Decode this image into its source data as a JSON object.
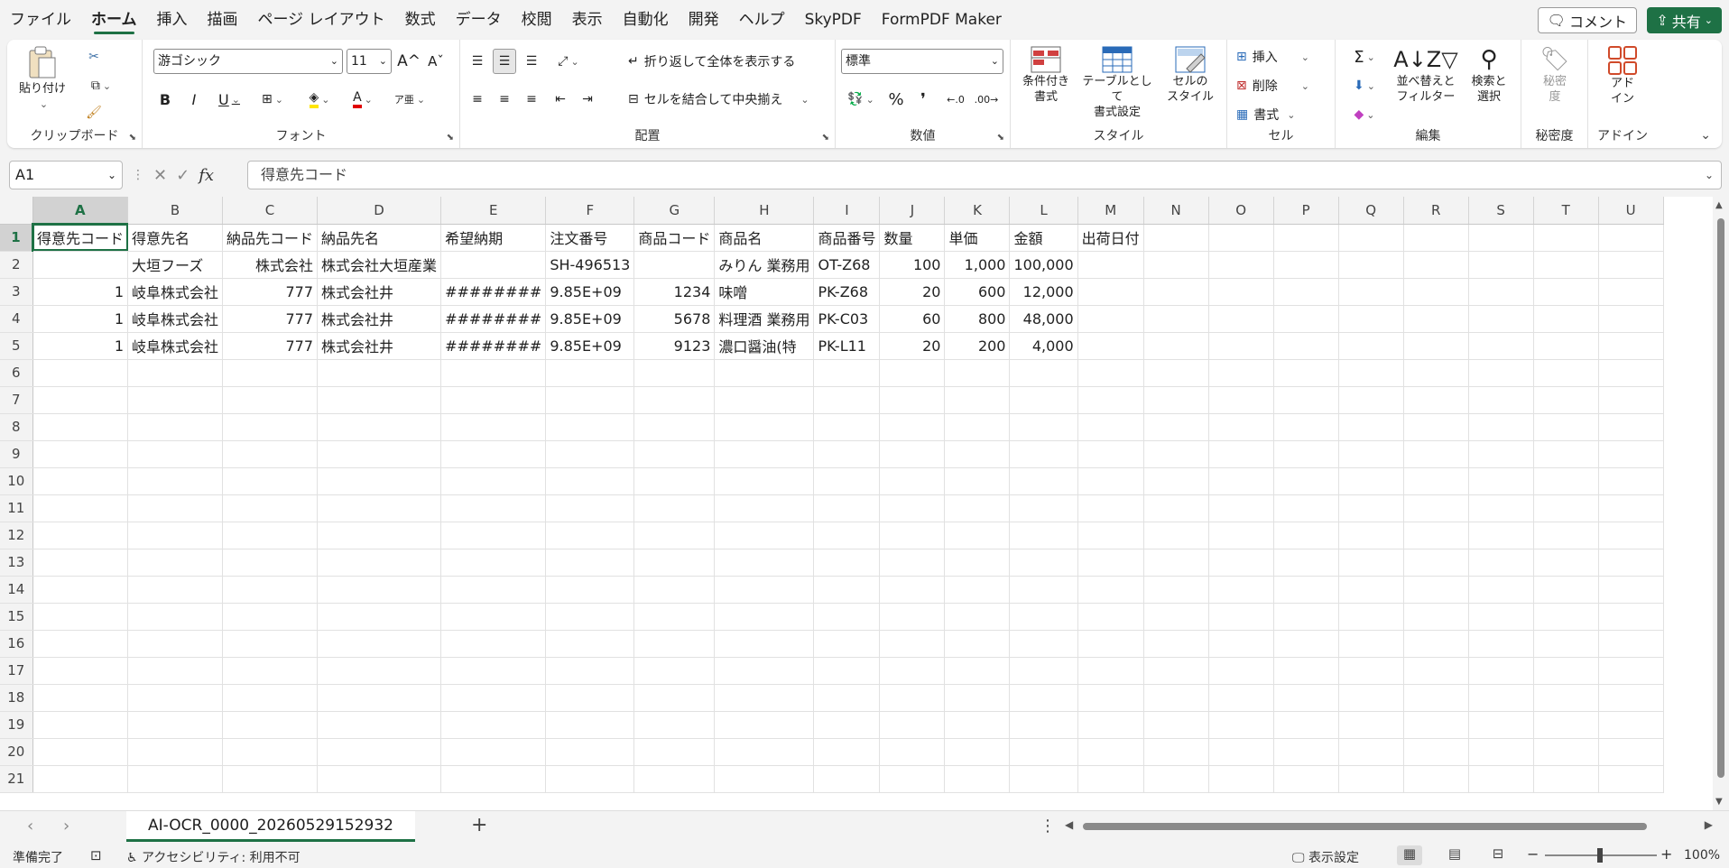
{
  "menu": {
    "tabs": [
      "ファイル",
      "ホーム",
      "挿入",
      "描画",
      "ページ レイアウト",
      "数式",
      "データ",
      "校閲",
      "表示",
      "自動化",
      "開発",
      "ヘルプ",
      "SkyPDF",
      "FormPDF Maker"
    ],
    "active_index": 1,
    "comment_label": "コメント",
    "share_label": "共有"
  },
  "ribbon": {
    "clipboard": {
      "label": "クリップボード",
      "paste": "貼り付け"
    },
    "font": {
      "label": "フォント",
      "font_name": "游ゴシック",
      "font_size": "11"
    },
    "alignment": {
      "label": "配置",
      "wrap": "折り返して全体を表示する",
      "merge": "セルを結合して中央揃え"
    },
    "number": {
      "label": "数値",
      "format": "標準"
    },
    "styles": {
      "label": "スタイル",
      "conditional": [
        "条件付き",
        "書式"
      ],
      "table": [
        "テーブルとして",
        "書式設定"
      ],
      "cell_style": [
        "セルの",
        "スタイル"
      ]
    },
    "cells": {
      "label": "セル",
      "insert": "挿入",
      "delete": "削除",
      "format": "書式"
    },
    "editing": {
      "label": "編集",
      "sort": [
        "並べ替えと",
        "フィルター"
      ],
      "find": [
        "検索と",
        "選択"
      ]
    },
    "sensitivity": {
      "label": "秘密度",
      "btn": [
        "秘密",
        "度"
      ]
    },
    "addin": {
      "label": "アドイン",
      "btn": [
        "アド",
        "イン"
      ]
    }
  },
  "formula_bar": {
    "cell_ref": "A1",
    "content": "得意先コード"
  },
  "sheet": {
    "columns": [
      "A",
      "B",
      "C",
      "D",
      "E",
      "F",
      "G",
      "H",
      "I",
      "J",
      "K",
      "L",
      "M",
      "N",
      "O",
      "P",
      "Q",
      "R",
      "S",
      "T",
      "U"
    ],
    "row_count": 21,
    "rows": [
      [
        "得意先コード",
        "得意先名",
        "納品先コード",
        "納品先名",
        "希望納期",
        "注文番号",
        "商品コード",
        "商品名",
        "商品番号",
        "数量",
        "単価",
        "金額",
        "出荷日付"
      ],
      [
        "",
        "大垣フーズ",
        "株式会社",
        "株式会社大垣産業",
        "",
        "SH-496513",
        "",
        "みりん 業務用",
        "OT-Z68",
        "100",
        "1,000",
        "100,000",
        ""
      ],
      [
        "1",
        "岐阜株式会社",
        "777",
        "株式会社井",
        "########",
        "9.85E+09",
        "1234",
        "味噌",
        "PK-Z68",
        "20",
        "600",
        "12,000",
        ""
      ],
      [
        "1",
        "岐阜株式会社",
        "777",
        "株式会社井",
        "########",
        "9.85E+09",
        "5678",
        "料理酒 業務用",
        "PK-C03",
        "60",
        "800",
        "48,000",
        ""
      ],
      [
        "1",
        "岐阜株式会社",
        "777",
        "株式会社井",
        "########",
        "9.85E+09",
        "9123",
        "濃口醤油(特",
        "PK-L11",
        "20",
        "200",
        "4,000",
        ""
      ]
    ],
    "numeric_columns": [
      0,
      2,
      6,
      9,
      10,
      11
    ],
    "tab_name": "AI-OCR_0000_20260529152932"
  },
  "status": {
    "ready": "準備完了",
    "accessibility": "アクセシビリティ: 利用不可",
    "display_settings": "表示設定",
    "zoom": "100%"
  },
  "colors": {
    "accent": "#1e7145"
  }
}
